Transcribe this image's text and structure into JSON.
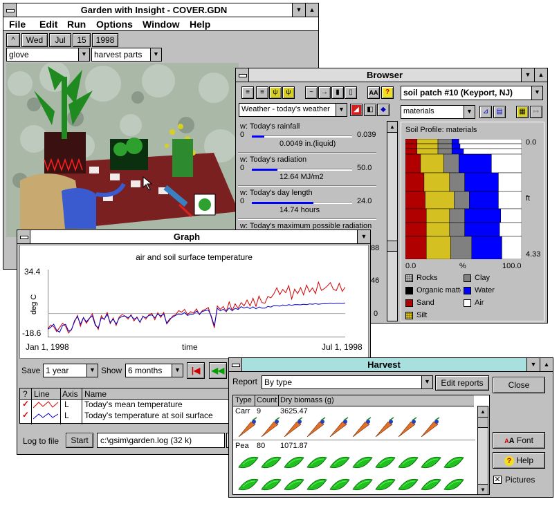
{
  "garden": {
    "title": "Garden with Insight - COVER.GDN",
    "menu": [
      "File",
      "Edit",
      "Run",
      "Options",
      "Window",
      "Help"
    ],
    "date": {
      "weekday": "Wed",
      "month": "Jul",
      "day": "15",
      "year": "1998"
    },
    "tool_select": "glove",
    "action_select": "harvest parts"
  },
  "browser": {
    "title": "Browser",
    "object_select": "soil patch #10 (Keyport, NJ)",
    "left_select": "Weather - today's weather",
    "right_select": "materials",
    "items": [
      {
        "label": "w: Today's rainfall",
        "min": "0",
        "max": "0.039",
        "value": "0.0049",
        "unit": "in.(liquid)",
        "level": 0.126
      },
      {
        "label": "w: Today's radiation",
        "min": "0",
        "max": "50.0",
        "value": "12.64",
        "unit": "MJ/m2",
        "level": 0.253
      },
      {
        "label": "w: Today's day length",
        "min": "0",
        "max": "24.0",
        "value": "14.74",
        "unit": "hours",
        "level": 0.614
      },
      {
        "label": "w: Today's maximum possible radiation",
        "min": "",
        "max": "",
        "value": "",
        "unit": "",
        "level": 0
      }
    ],
    "partial_values": [
      "88",
      "46",
      "0"
    ],
    "soil_title": "Soil Profile: materials",
    "depth_top": "0.0",
    "depth_unit": "ft",
    "depth_bottom": "4.33",
    "pct_left": "0.0",
    "pct_mid": "%",
    "pct_right": "100.0",
    "legend": [
      {
        "name": "Rocks",
        "color": "#888888"
      },
      {
        "name": "Clay",
        "color": "#808080"
      },
      {
        "name": "Organic matter",
        "color": "#000000"
      },
      {
        "name": "Water",
        "color": "#0000ff"
      },
      {
        "name": "Sand",
        "color": "#b00000"
      },
      {
        "name": "Air",
        "color": "#ffffff"
      },
      {
        "name": "Silt",
        "color": "#d4c020"
      }
    ]
  },
  "graph": {
    "title": "Graph",
    "save_label": "Save",
    "save_select": "1 year",
    "show_label": "Show",
    "show_select": "6 months",
    "col_headers": [
      "?",
      "Line",
      "Axis",
      "Name"
    ],
    "rows": [
      {
        "axis": "L",
        "name": "Today's mean temperature"
      },
      {
        "axis": "L",
        "name": "Today's temperature at soil surface"
      }
    ],
    "log_label": "Log to file",
    "start_button": "Start",
    "log_path": "c:\\gsim\\garden.log (32 k)"
  },
  "chart_data": {
    "type": "line",
    "title": "air and soil surface temperature",
    "xlabel": "time",
    "ylabel": "deg C",
    "x_start_label": "Jan 1, 1998",
    "x_end_label": "Jul 1, 1998",
    "y_max_label": "34.4",
    "y_min_label": "-18.6",
    "ylim": [
      -18.6,
      34.4
    ],
    "series": [
      {
        "color": "#d00000",
        "values": [
          -12.1,
          -8.9,
          -10.2,
          -14.1,
          -10.9,
          -7.6,
          -9.9,
          -15.3,
          -12.2,
          -6.6,
          -1.4,
          -9.9,
          -3.1,
          -7.6,
          -3.9,
          -0.1,
          -8.3,
          -12.4,
          -1.7,
          -4.8,
          0.8,
          -7.9,
          -3.4,
          -9.3,
          -2.8,
          -0.8,
          -1.9,
          -4.4,
          -0.8,
          -5.8,
          -2.6,
          -7.0,
          -1.9,
          -4.4,
          -0.9,
          0.1,
          -4.8,
          0.6,
          -3.1,
          0.9,
          -8.1,
          -5.2,
          -1.9,
          -0.9,
          2.3,
          1.1,
          3.3,
          -0.8,
          1.4,
          0.5,
          3.7,
          -0.9,
          2.4,
          3.3,
          4.7,
          -3.1,
          -11.2,
          5.9,
          3.3,
          5.6,
          1.4,
          9.1,
          2.3,
          7.6,
          4.0,
          8.6,
          6.0,
          10.6,
          6.0,
          12.0,
          5.7,
          13.7,
          8.6,
          8.1,
          13.4,
          12.3,
          15.4,
          20.2,
          14.8,
          18.9,
          16.3,
          21.8,
          11.4,
          19.1,
          15.6,
          20.3,
          14.6,
          22.3,
          17.0,
          20.1,
          15.6,
          24.6,
          18.1,
          19.6,
          21.6,
          24.2,
          19.0,
          18.0,
          23.7,
          17.3,
          20.7
        ]
      },
      {
        "color": "#0000c8",
        "values": [
          -12.3,
          -10.8,
          -8.3,
          -13.1,
          -14.6,
          -9.3,
          -8.5,
          -13.8,
          -12.7,
          -5.6,
          -2.3,
          -8.3,
          -3.2,
          -6.5,
          -3.6,
          -1.8,
          -9.3,
          -11.1,
          -3.3,
          -4.4,
          -0.6,
          -6.9,
          -4.4,
          -8.2,
          -3.6,
          -2.2,
          -1.9,
          -3.3,
          -1.6,
          -4.4,
          -3.2,
          -6.6,
          -2.4,
          -3.2,
          -1.5,
          -1.1,
          -3.3,
          -0.3,
          -1.9,
          -0.3,
          -7.6,
          -4.1,
          -2.8,
          -1.4,
          -0.3,
          -0.7,
          0.8,
          -1.5,
          -0.6,
          -0.4,
          1.9,
          -0.4,
          1.7,
          2.3,
          2.8,
          -2.2,
          -9.6,
          4.1,
          2.1,
          3.4,
          1.6,
          4.4,
          2.2,
          4.1,
          3.2,
          5.4,
          4.3,
          5.2,
          3.9,
          5.3,
          3.7,
          5.2,
          4.3,
          4.2,
          5.6,
          5.1,
          6.3,
          6.2,
          5.8,
          6.7,
          6.2,
          6.9,
          6.5,
          6.9,
          7.0,
          6.8,
          7.3,
          6.9,
          7.6,
          7.3,
          7.7,
          7.3,
          7.6,
          7.8,
          7.7,
          8.2,
          7.8,
          8.1,
          8.1,
          7.9,
          8.3
        ]
      }
    ]
  },
  "harvest": {
    "title": "Harvest",
    "report_label": "Report",
    "report_select": "By type",
    "edit_reports": "Edit reports",
    "close": "Close",
    "font": "Font",
    "help": "Help",
    "pictures": "Pictures",
    "col_headers": [
      "Type",
      "Count",
      "Dry biomass (g)"
    ],
    "rows": [
      {
        "type": "Carr",
        "count": "9",
        "biomass": "3625.47"
      },
      {
        "type": "Pea",
        "count": "80",
        "biomass": "1071.87"
      }
    ]
  }
}
